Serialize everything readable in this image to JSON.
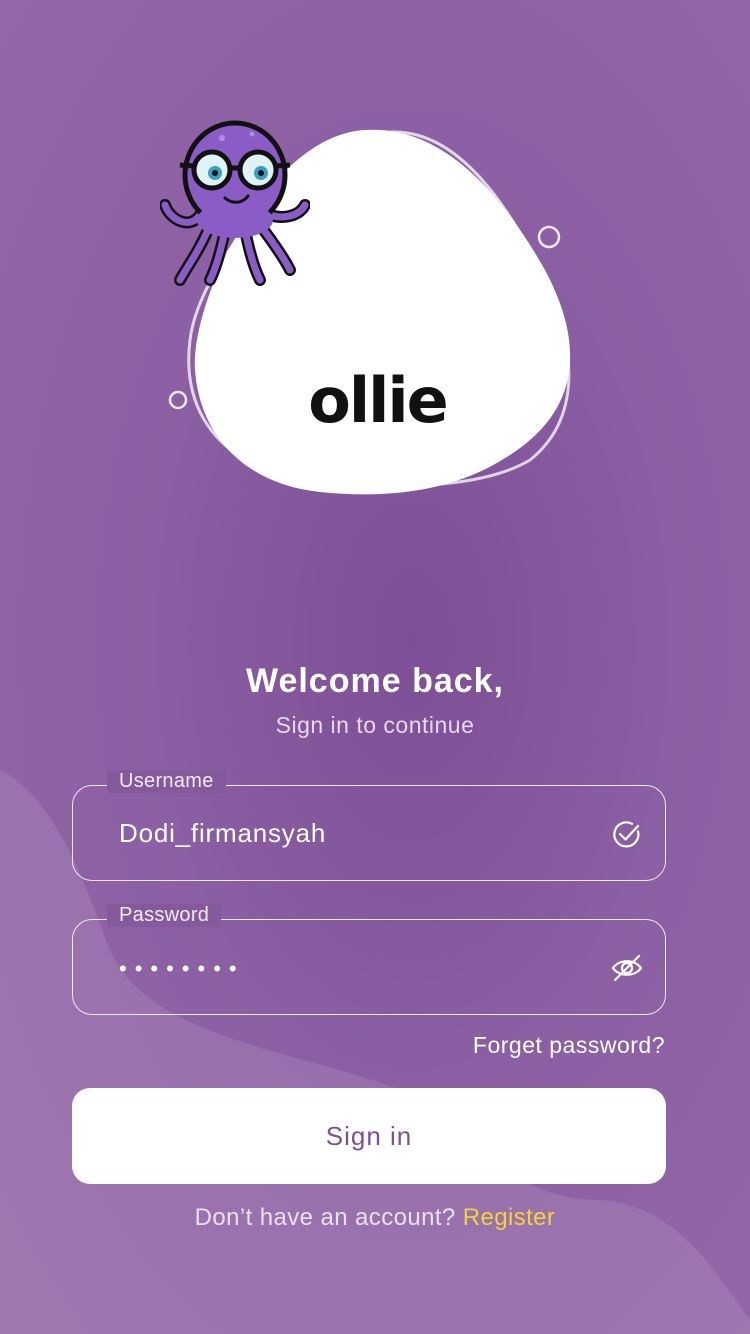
{
  "brand": {
    "name": "ollie",
    "logo_icon": "octopus-mascot-icon"
  },
  "heading": {
    "title": "Welcome back,",
    "subtitle": "Sign in to continue"
  },
  "form": {
    "username": {
      "label": "Username",
      "value": "Dodi_firmansyah",
      "status_icon": "check-circle-icon"
    },
    "password": {
      "label": "Password",
      "masked_value": "••••••••",
      "toggle_icon": "eye-off-icon"
    },
    "forgot_label": "Forget password?",
    "submit_label": "Sign in"
  },
  "footer": {
    "prompt": "Don’t have an account?",
    "register_label": "Register"
  },
  "colors": {
    "background": "#8b5fa3",
    "accent_link": "#f2d43a",
    "button_text": "#7e4f97",
    "mascot": "#8a5cc6"
  }
}
